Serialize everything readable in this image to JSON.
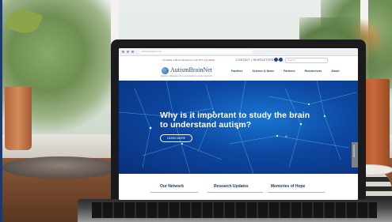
{
  "browser": {
    "url": "autismbrainnet.org"
  },
  "site": {
    "tagline": "To Make a Brain Donation, Call",
    "phone": "877-333-0999",
    "utility_links": [
      "CONTACT",
      "NEWSLETTER",
      "FAQ"
    ],
    "search_placeholder": "Search",
    "logo_text": "AutismBrainNet",
    "logo_subtitle": "Helping understand the human brain for autism spectrum"
  },
  "nav": {
    "items": [
      "Families",
      "Science & News",
      "Partners",
      "Researchers",
      "About"
    ]
  },
  "hero": {
    "title": "Why is it important to study the brain to understand autism?",
    "button_label": "LEARN MORE",
    "side_tab_label": "FEEDBACK"
  },
  "footer_tabs": {
    "items": [
      "Our Network",
      "Research Updates",
      "Memories of Hope"
    ]
  },
  "colors": {
    "hero_blue": "#0d47a1",
    "nav_blue": "#2b4a8a",
    "phone_red": "#b33a3a"
  },
  "icons": [
    "facebook-icon",
    "twitter-icon",
    "search-icon"
  ]
}
